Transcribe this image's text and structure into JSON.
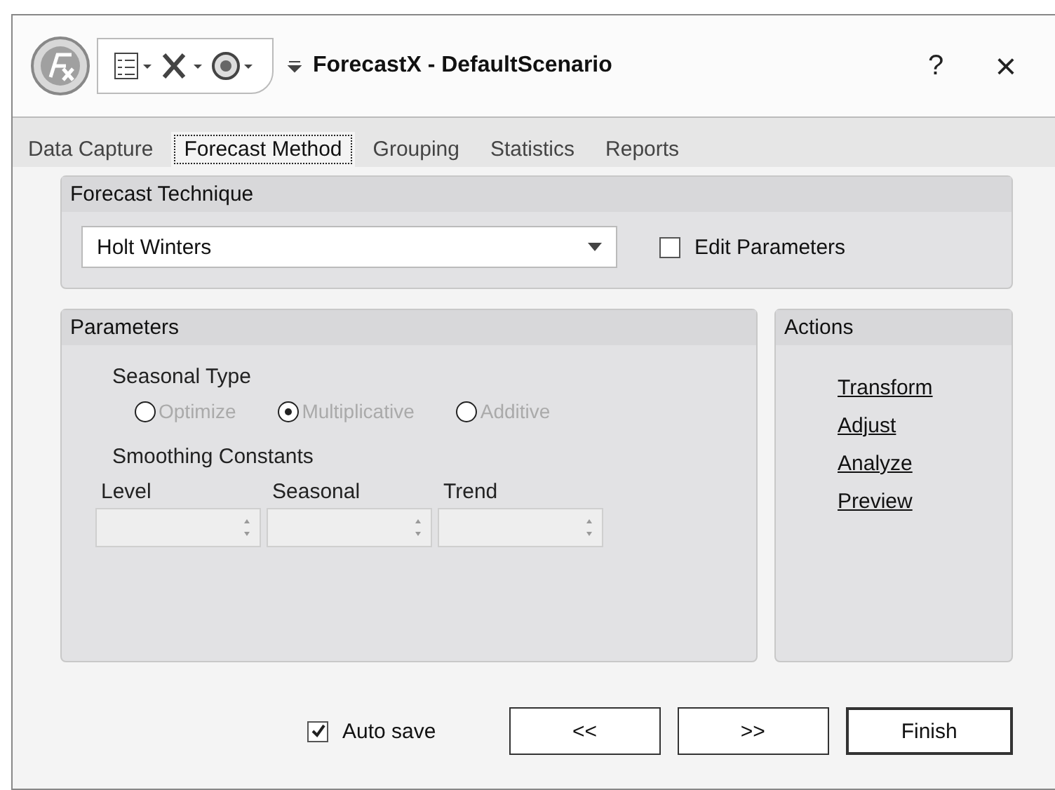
{
  "window": {
    "title": "ForecastX - DefaultScenario",
    "help": "?",
    "close": "×"
  },
  "tabs": [
    {
      "label": "Data Capture",
      "selected": false
    },
    {
      "label": "Forecast Method",
      "selected": true
    },
    {
      "label": "Grouping",
      "selected": false
    },
    {
      "label": "Statistics",
      "selected": false
    },
    {
      "label": "Reports",
      "selected": false
    }
  ],
  "technique": {
    "title": "Forecast Technique",
    "value": "Holt Winters",
    "edit_parameters": {
      "label": "Edit Parameters",
      "checked": false
    }
  },
  "parameters": {
    "title": "Parameters",
    "seasonal_type": {
      "label": "Seasonal Type",
      "disabled": true,
      "options": [
        {
          "label": "Optimize",
          "selected": false
        },
        {
          "label": "Multiplicative",
          "selected": true
        },
        {
          "label": "Additive",
          "selected": false
        }
      ]
    },
    "smoothing_label": "Smoothing Constants",
    "constants": [
      {
        "label": "Level",
        "disabled": true
      },
      {
        "label": "Seasonal",
        "disabled": true
      },
      {
        "label": "Trend",
        "disabled": true
      }
    ]
  },
  "actions": {
    "title": "Actions",
    "links": [
      "Transform",
      "Adjust",
      "Analyze",
      "Preview"
    ]
  },
  "auto_save": {
    "label": "Auto save",
    "checked": true
  },
  "buttons": [
    {
      "label": "<<",
      "default": false
    },
    {
      "label": ">>",
      "default": false
    },
    {
      "label": "Finish",
      "default": true
    }
  ]
}
